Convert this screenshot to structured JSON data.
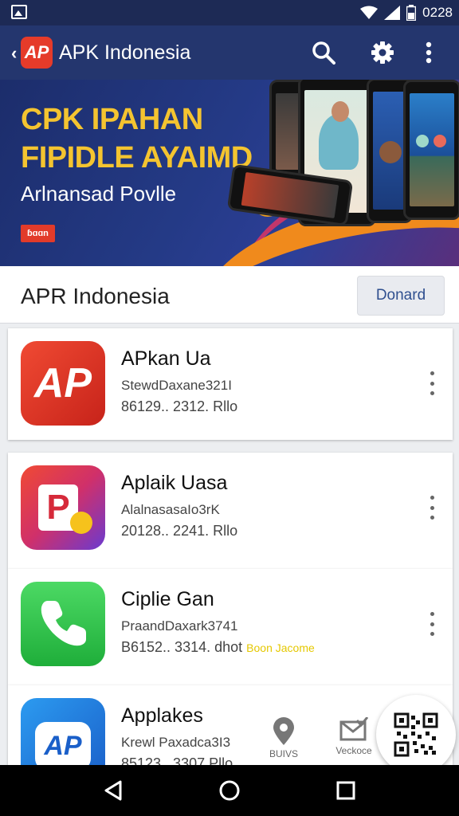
{
  "status_bar": {
    "time": "0228"
  },
  "app_bar": {
    "logo_text": "AP",
    "title": "APK Indonesia"
  },
  "banner": {
    "headline_line1": "CPK IPAHAN",
    "headline_line2": "FIPIDLE AYAIMD",
    "subtitle": "Arlnansad Povlle",
    "badge": "ɓɑɑn"
  },
  "section": {
    "title": "APR Indonesia",
    "button_label": "Donard"
  },
  "apps": [
    {
      "name": "APkan Ua",
      "package": "StewdDaxane321I",
      "meta": "86129.. 2312. Rllo",
      "highlight": ""
    },
    {
      "name": "Aplaik Uasa",
      "package": "AlalnasasaIo3rK",
      "meta": "20128.. 2241. Rllo",
      "highlight": ""
    },
    {
      "name": "Ciplie Gan",
      "package": "PraandDaxark3741",
      "meta": "B6152.. 3314. dhot",
      "highlight": "Boon Jacome"
    },
    {
      "name": "Applakes",
      "package": "Krewl Paxadca3I3",
      "meta": "85123.. 3307 Pllo",
      "highlight": ""
    }
  ],
  "bottom_tabs": [
    {
      "label": "BUIVS"
    },
    {
      "label": "Veckoce"
    }
  ],
  "icons": {
    "back": "chevron-left-icon",
    "search": "search-icon",
    "settings": "gear-icon",
    "more": "more-vert-icon",
    "qr": "qr-code-icon",
    "location": "location-pin-icon",
    "mail": "mail-check-icon"
  },
  "colors": {
    "app_bar": "#24366e",
    "status_bar": "#1d2a55",
    "accent_red": "#e53b2a",
    "banner_yellow": "#f4c430"
  }
}
